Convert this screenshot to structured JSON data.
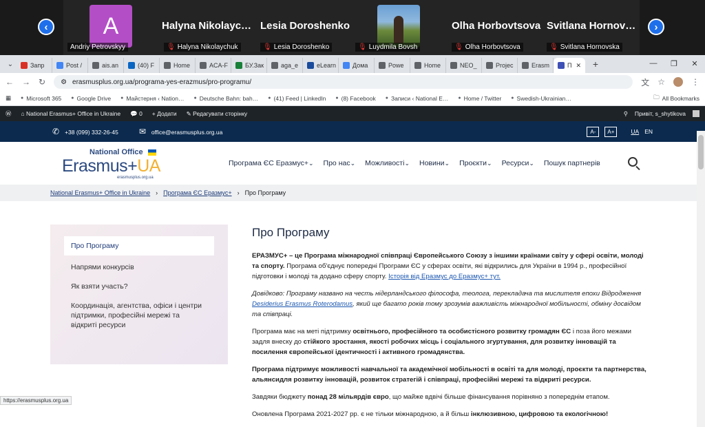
{
  "meeting": {
    "tiles": [
      {
        "name": "Andriy Petrovskyy",
        "initial": "A",
        "muted": false
      },
      {
        "name": "Halyna Nikolaychuk",
        "big": "Halyna Nikolayc…",
        "muted": true
      },
      {
        "name": "Lesia Doroshenko",
        "big": "Lesia Doroshenko",
        "muted": true
      },
      {
        "name": "Luydmila Bovsh",
        "muted": true
      },
      {
        "name": "Olha Horbovtsova",
        "big": "Olha Horbovtsova",
        "muted": true
      },
      {
        "name": "Svitlana Hornovska",
        "big": "Svitlana Hornov…",
        "muted": true
      }
    ]
  },
  "browser": {
    "tabs": [
      "Запр",
      "Post /",
      "ais.an",
      "(40) F",
      "Home",
      "ACA-F",
      "БУ.Зак",
      "aga_e",
      "eLearn",
      "Дома",
      "Powe",
      "Home",
      "NEO_",
      "Projec",
      "Erasm",
      "П"
    ],
    "tab_colors": [
      "#d93025",
      "#4285f4",
      "#5f6368",
      "#0a66c2",
      "#5f6368",
      "#5f6368",
      "#188038",
      "#5f6368",
      "#1a4b9c",
      "#4285f4",
      "#5f6368",
      "#5f6368",
      "#5f6368",
      "#5f6368",
      "#5f6368",
      "#3f51b5"
    ],
    "url": "erasmusplus.org.ua/programa-yes-erazmus/pro-programu/",
    "bookmarks": [
      "Microsoft 365",
      "Google Drive",
      "Майстерня ‹ Nation…",
      "Deutsche Bahn: bah…",
      "(41) Feed | LinkedIn",
      "(8) Facebook",
      "Записи ‹ National E…",
      "Home / Twitter",
      "Swedish-Ukrainian…"
    ],
    "all_bookmarks": "All Bookmarks",
    "status_url": "https://erasmusplus.org.ua"
  },
  "wp_admin": {
    "site": "National Erasmus+ Office in Ukraine",
    "comments": "0",
    "add": "Додати",
    "edit": "Редагувати сторінку",
    "greeting": "Привіт, s_shytikova"
  },
  "topbar": {
    "phone": "+38 (099) 332-26-45",
    "email": "office@erasmusplus.org.ua",
    "font_minus": "A-",
    "font_plus": "A+",
    "lang_ua": "UA",
    "lang_en": "EN"
  },
  "logo": {
    "national_office": "National Office",
    "erasmus": "Erasmus+",
    "ua": "UA",
    "url": "erasmusplus.org.ua"
  },
  "nav": [
    "Програма ЄС Еразмус+",
    "Про нас",
    "Можливості",
    "Новини",
    "Проєкти",
    "Ресурси",
    "Пошук партнерів"
  ],
  "breadcrumb": {
    "home": "National Erasmus+ Office in Ukraine",
    "section": "Програма ЄС Еразмус+",
    "current": "Про Програму"
  },
  "sidebar": [
    "Про Програму",
    "Напрями конкурсів",
    "Як взяти участь?",
    "Координація, агентства, офіси і центри підтримки, професійні мережі та відкриті ресурси"
  ],
  "article": {
    "title": "Про Програму",
    "p1_bold": "ЕРАЗМУС+ – це Програма міжнародної співпраці Європейського Союзу з іншими країнами світу у сфері освіти, молоді та спорту.",
    "p1_rest": " Програма об'єднує попередні Програми ЄС у сферах освіти, які відкрились для України в 1994 р., професійної підготовки і молоді та додано сферу спорту. ",
    "p1_link": "Історія від Еразмус до Еразмус+ тут.",
    "p2_a": "Довідково: Програму названо на честь нідерландського філософа, теолога, перекладача та мислителя епохи Відродження ",
    "p2_link": "Desiderius Erasmus Roterodamus",
    "p2_b": ", який ще багато років тому зрозумів важливість міжнародної мобільності, обміну досвідом та співпраці.",
    "p3_a": "Програма має на меті підтримку ",
    "p3_b": "освітнього, професійного та особистісного розвитку громадян ЄС",
    "p3_c": " і поза його межами задля внеску до ",
    "p3_d": "стійкого зростання, якості робочих місць і соціального згуртування, для розвитку інновацій та посилення європейської ідентичності і активного громадянства.",
    "p4": "Програма підтримує можливості навчальної та академічної мобільності в освіті та для молоді, проєкти та партнерства, альянсидля розвитку інновацій, розвиток стратегій і співпраці, професійні мережі та відкриті ресурси.",
    "p5_a": "Завдяки бюджету ",
    "p5_b": "понад 28 мільярдів євро",
    "p5_c": ", що майже вдвічі більше фінансування порівняно з попереднім етапом.",
    "p6_a": "Оновлена Програма 2021-2027 рр. є не тільки міжнародною, а й більш ",
    "p6_b": "інклюзивною, цифровою та екологічною!"
  }
}
